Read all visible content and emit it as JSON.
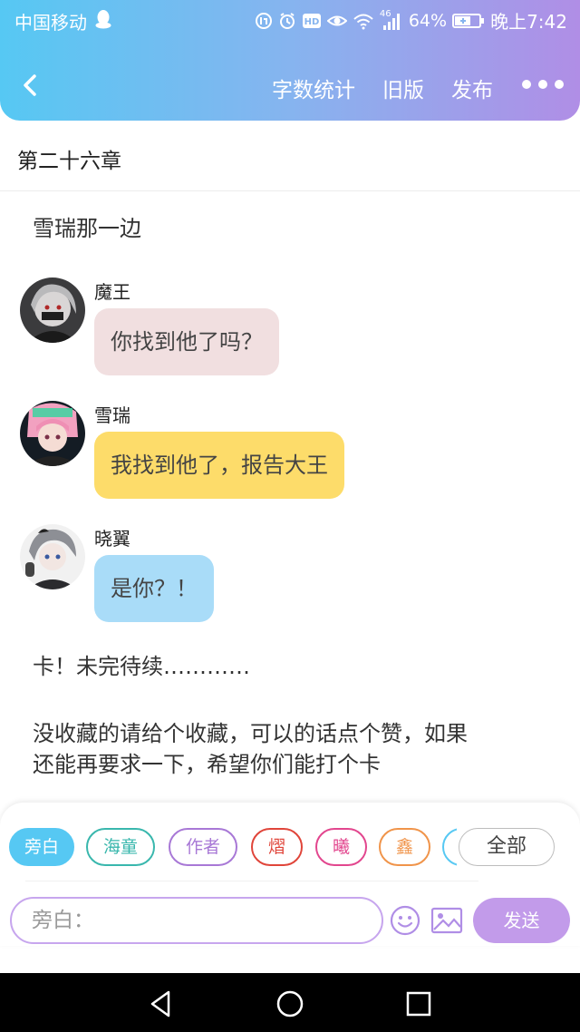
{
  "status_bar": {
    "carrier": "中国移动",
    "network": "46",
    "battery": "64%",
    "time": "晚上7:42"
  },
  "nav": {
    "links": [
      "字数统计",
      "旧版",
      "发布"
    ]
  },
  "chapter": {
    "title": "第二十六章"
  },
  "narrations": [
    "雪瑞那一边",
    "卡！未完待续…………",
    "没收藏的请给个收藏，可以的话点个赞，如果",
    "还能再要求一下，希望你们能打个卡"
  ],
  "messages": [
    {
      "name": "魔王",
      "text": "你找到他了吗？",
      "bubble_color": "#f1dfe0"
    },
    {
      "name": "雪瑞",
      "text": "我找到他了，报告大王",
      "bubble_color": "#fddc6a"
    },
    {
      "name": "晓翼",
      "text": "是你？！",
      "bubble_color": "#a9dcf8"
    }
  ],
  "characters": [
    {
      "label": "旁白",
      "color": "#56c8f3",
      "selected": true
    },
    {
      "label": "海童",
      "color": "#39b7ad",
      "selected": false
    },
    {
      "label": "作者",
      "color": "#a878d6",
      "selected": false
    },
    {
      "label": "熠",
      "color": "#e0453a",
      "selected": false
    },
    {
      "label": "曦",
      "color": "#e2468e",
      "selected": false
    },
    {
      "label": "鑫",
      "color": "#f0944a",
      "selected": false
    }
  ],
  "all_chip": "全部",
  "composer": {
    "placeholder": "旁白：",
    "send_label": "发送"
  },
  "colors": {
    "header_start": "#56c8f3",
    "header_end": "#b08ee6",
    "send_button": "#c29bea"
  }
}
